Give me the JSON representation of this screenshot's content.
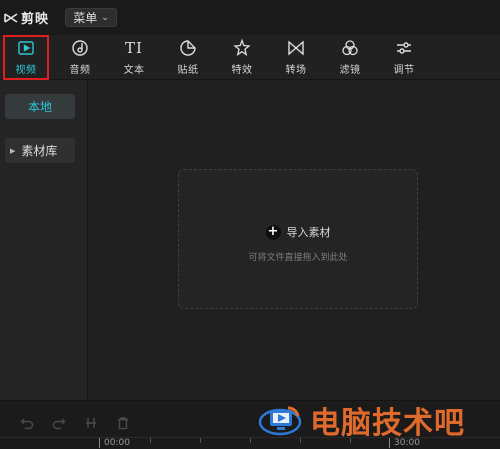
{
  "app": {
    "name": "剪映",
    "menu_label": "菜单"
  },
  "toolbar": {
    "items": [
      {
        "label": "视频",
        "icon": "video-play-icon",
        "active": true
      },
      {
        "label": "音频",
        "icon": "music-disc-icon"
      },
      {
        "label": "文本",
        "icon": "text-ti-icon"
      },
      {
        "label": "贴纸",
        "icon": "sticker-icon"
      },
      {
        "label": "特效",
        "icon": "sparkle-star-icon"
      },
      {
        "label": "转场",
        "icon": "bowtie-transition-icon"
      },
      {
        "label": "滤镜",
        "icon": "filter-circles-icon"
      },
      {
        "label": "调节",
        "icon": "sliders-adjust-icon"
      }
    ]
  },
  "sidebar": {
    "local_label": "本地",
    "library_label": "素材库"
  },
  "dropzone": {
    "import_label": "导入素材",
    "hint": "可将文件直接拖入到此处"
  },
  "timeline": {
    "start_time": "00:00",
    "end_time": "30:00"
  },
  "watermark": {
    "text": "电脑技术吧"
  },
  "colors": {
    "accent": "#2ec6d6",
    "active_border": "#e02020",
    "watermark": "#e06a2c"
  }
}
